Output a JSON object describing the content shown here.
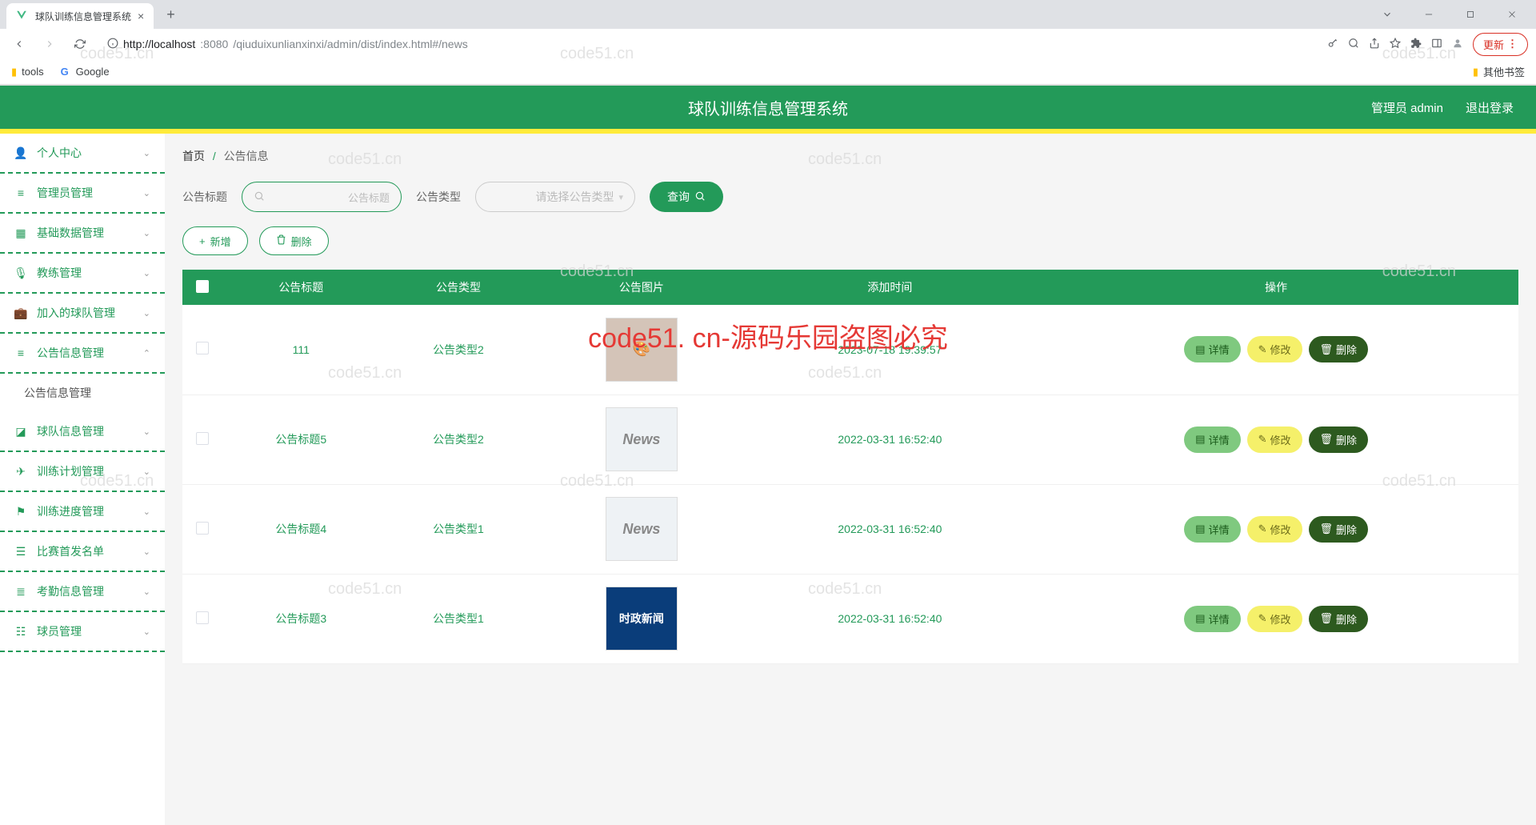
{
  "browser": {
    "tab_title": "球队训练信息管理系统",
    "url_host": "http://localhost",
    "url_port": ":8080",
    "url_path": "/qiuduixunlianxinxi/admin/dist/index.html#/news",
    "update_label": "更新",
    "bookmarks": {
      "tools": "tools",
      "google": "Google",
      "other": "其他书签"
    }
  },
  "header": {
    "system_title": "球队训练信息管理系统",
    "admin_label": "管理员 admin",
    "logout": "退出登录"
  },
  "sidebar": {
    "items": [
      {
        "label": "个人中心",
        "expandable": true
      },
      {
        "label": "管理员管理",
        "expandable": true
      },
      {
        "label": "基础数据管理",
        "expandable": true
      },
      {
        "label": "教练管理",
        "expandable": true
      },
      {
        "label": "加入的球队管理",
        "expandable": true
      },
      {
        "label": "公告信息管理",
        "expandable": true,
        "expanded": true,
        "children": [
          "公告信息管理"
        ]
      },
      {
        "label": "球队信息管理",
        "expandable": true
      },
      {
        "label": "训练计划管理",
        "expandable": true
      },
      {
        "label": "训练进度管理",
        "expandable": true
      },
      {
        "label": "比赛首发名单",
        "expandable": true
      },
      {
        "label": "考勤信息管理",
        "expandable": true
      },
      {
        "label": "球员管理",
        "expandable": true
      }
    ]
  },
  "breadcrumb": {
    "home": "首页",
    "current": "公告信息"
  },
  "search": {
    "title_label": "公告标题",
    "title_placeholder": "公告标题",
    "type_label": "公告类型",
    "type_placeholder": "请选择公告类型",
    "query_btn": "查询"
  },
  "toolbar": {
    "add": "新增",
    "delete": "删除"
  },
  "table": {
    "headers": [
      "",
      "公告标题",
      "公告类型",
      "公告图片",
      "添加时间",
      "操作"
    ],
    "actions": {
      "detail": "详情",
      "edit": "修改",
      "delete": "删除"
    },
    "rows": [
      {
        "title": "111",
        "type": "公告类型2",
        "img": "illust",
        "time": "2023-07-18 19:39:57"
      },
      {
        "title": "公告标题5",
        "type": "公告类型2",
        "img": "news",
        "time": "2022-03-31 16:52:40"
      },
      {
        "title": "公告标题4",
        "type": "公告类型1",
        "img": "news",
        "time": "2022-03-31 16:52:40"
      },
      {
        "title": "公告标题3",
        "type": "公告类型1",
        "img": "news-blue",
        "img_text": "时政新闻",
        "time": "2022-03-31 16:52:40"
      }
    ]
  },
  "watermark": {
    "main": "code51. cn-源码乐园盗图必究",
    "light": "code51.cn"
  }
}
